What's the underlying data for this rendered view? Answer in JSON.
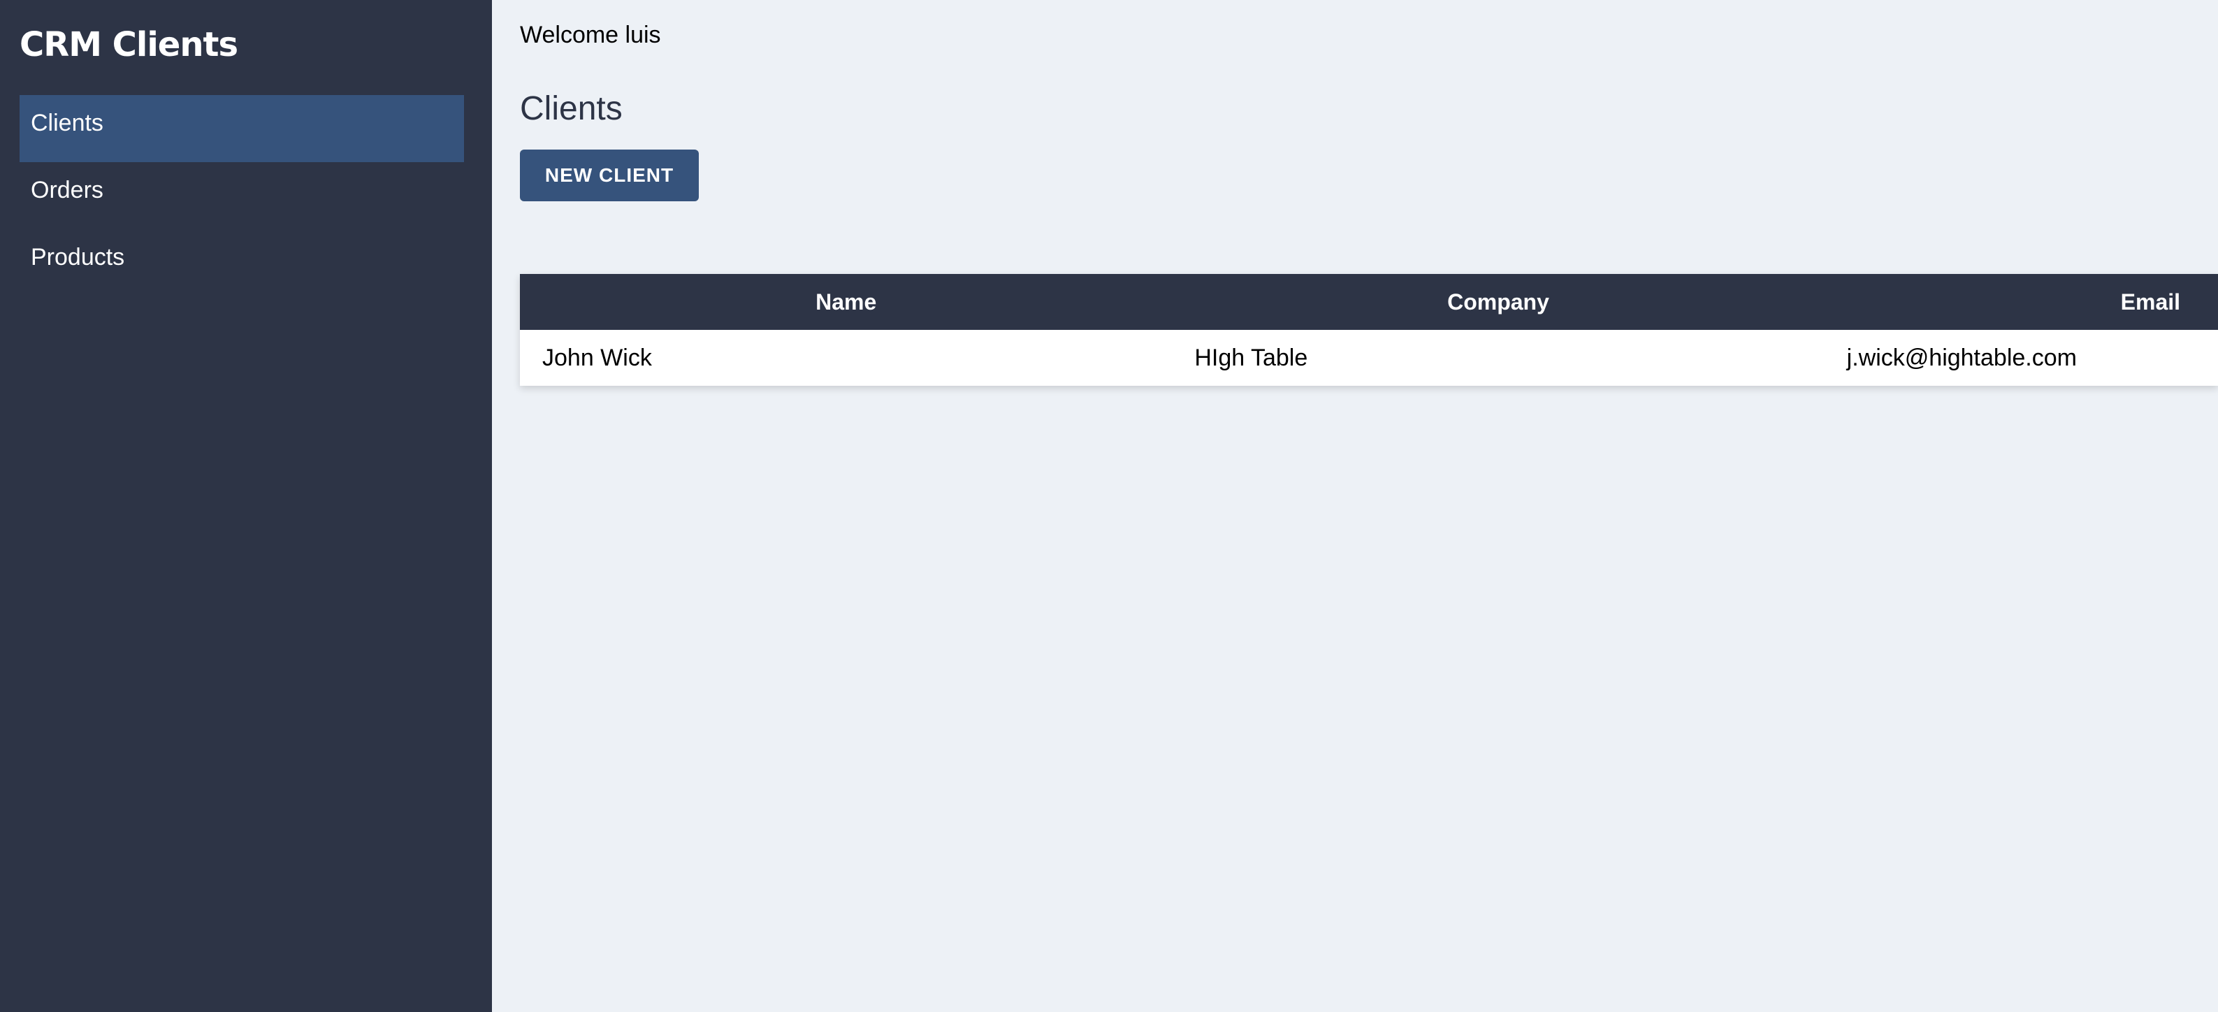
{
  "sidebar": {
    "title": "CRM Clients",
    "items": [
      {
        "label": "Clients",
        "active": true
      },
      {
        "label": "Orders",
        "active": false
      },
      {
        "label": "Products",
        "active": false
      }
    ]
  },
  "header": {
    "welcome": "Welcome luis"
  },
  "main": {
    "title": "Clients",
    "new_button_label": "NEW CLIENT"
  },
  "table": {
    "columns": [
      "Name",
      "Company",
      "Email"
    ],
    "rows": [
      [
        "John Wick",
        "HIgh Table",
        "j.wick@hightable.com"
      ]
    ]
  },
  "colors": {
    "sidebar_bg": "#2d3446",
    "accent": "#36537c",
    "page_bg": "#edf1f6"
  }
}
